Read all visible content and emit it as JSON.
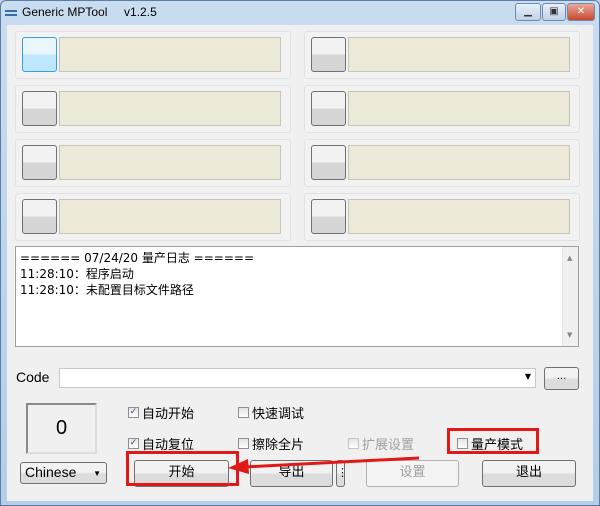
{
  "window": {
    "title": "Generic MPTool",
    "version": "v1.2.5",
    "controls": [
      "minimize",
      "maximize",
      "close"
    ]
  },
  "slots": [
    {
      "id": 1,
      "active": true
    },
    {
      "id": 2
    },
    {
      "id": 3
    },
    {
      "id": 4
    },
    {
      "id": 5
    },
    {
      "id": 6
    },
    {
      "id": 7
    },
    {
      "id": 8
    }
  ],
  "log": {
    "lines": [
      "====== 07/24/20 量产日志 ======",
      "11:28:10：程序启动",
      "11:28:10：未配置目标文件路径"
    ]
  },
  "code": {
    "label": "Code",
    "value": "",
    "browse_label": "..."
  },
  "counter": {
    "value": "0"
  },
  "checkboxes": {
    "auto_start": {
      "label": "自动开始",
      "checked": true
    },
    "fast_debug": {
      "label": "快速调试",
      "checked": false
    },
    "auto_reset": {
      "label": "自动复位",
      "checked": true
    },
    "erase_all": {
      "label": "擦除全片",
      "checked": false
    },
    "ext_settings": {
      "label": "扩展设置",
      "checked": false,
      "disabled": true
    },
    "mp_mode": {
      "label": "量产模式",
      "checked": false
    }
  },
  "language": {
    "selected": "Chinese"
  },
  "buttons": {
    "start": "开始",
    "export": "导出",
    "export_more": "⋮",
    "settings": "设置",
    "exit": "退出"
  },
  "annotation": {
    "color": "#e01818"
  }
}
